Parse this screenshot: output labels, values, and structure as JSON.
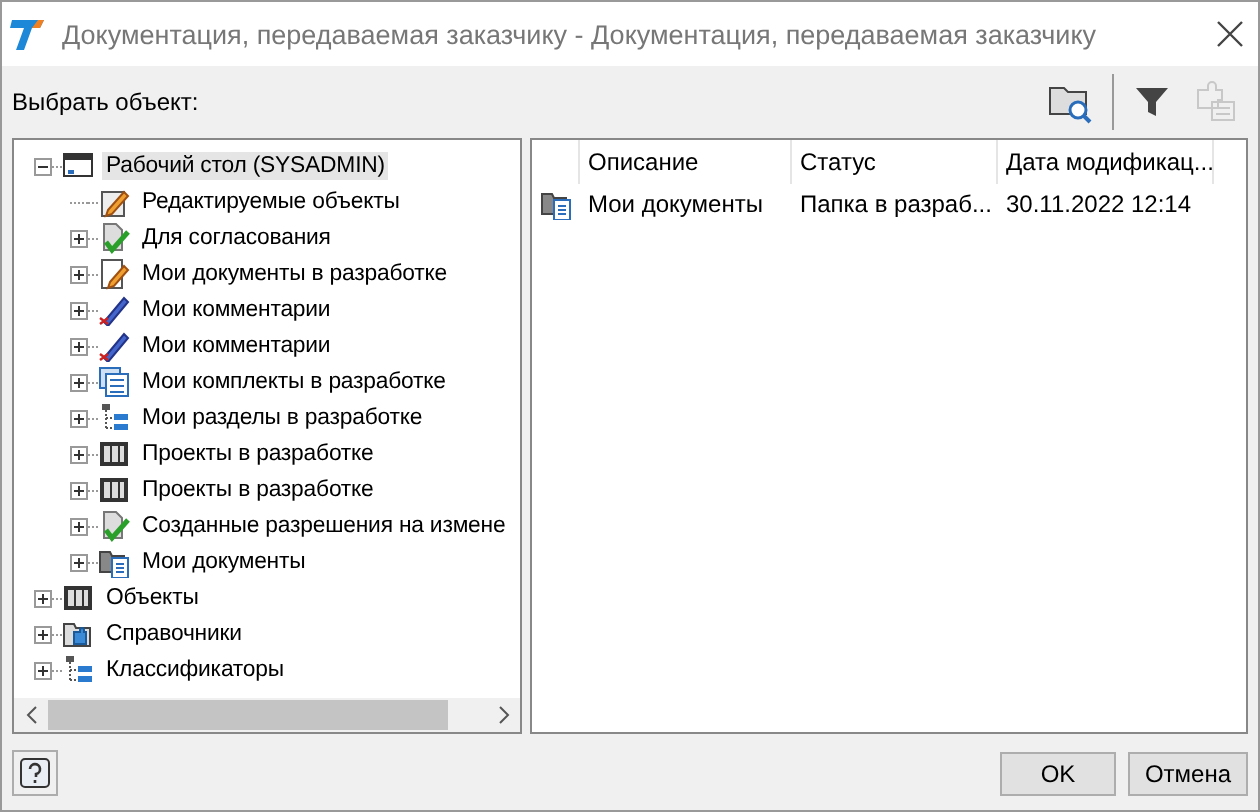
{
  "window": {
    "title": "Документация, передаваемая заказчику - Документация, передаваемая заказчику"
  },
  "prompt": "Выбрать объект:",
  "toolbar": [
    {
      "kind": "browse",
      "disabled": false
    },
    {
      "kind": "filter",
      "disabled": false
    },
    {
      "kind": "plugin",
      "disabled": true
    }
  ],
  "tree": [
    {
      "label": "Рабочий стол (SYSADMIN)",
      "kind": "desktop",
      "expanded": true,
      "selected": true,
      "children": [
        {
          "label": "Редактируемые объекты",
          "kind": "edit-list",
          "selected": false
        },
        {
          "label": "Для согласования",
          "kind": "approval",
          "expanded": false,
          "selected": false
        },
        {
          "label": "Мои документы в разработке",
          "kind": "document",
          "expanded": false,
          "selected": false
        },
        {
          "label": "Мои комментарии",
          "kind": "comments",
          "expanded": false,
          "selected": false
        },
        {
          "label": "Мои комментарии",
          "kind": "comments",
          "expanded": false,
          "selected": false
        },
        {
          "label": "Мои комплекты в разработке",
          "kind": "sets",
          "expanded": false,
          "selected": false
        },
        {
          "label": "Мои разделы в разработке",
          "kind": "sections",
          "expanded": false,
          "selected": false
        },
        {
          "label": "Проекты в разработке",
          "kind": "projects",
          "expanded": false,
          "selected": false
        },
        {
          "label": "Проекты в разработке",
          "kind": "projects",
          "expanded": false,
          "selected": false
        },
        {
          "label": "Созданные разрешения на измене",
          "kind": "approval",
          "expanded": false,
          "selected": false
        },
        {
          "label": "Мои документы",
          "kind": "folder",
          "expanded": false,
          "selected": false
        }
      ]
    },
    {
      "label": "Объекты",
      "kind": "projects",
      "expanded": false,
      "selected": false
    },
    {
      "label": "Справочники",
      "kind": "references",
      "expanded": false,
      "selected": false
    },
    {
      "label": "Классификаторы",
      "kind": "sections",
      "expanded": false,
      "selected": false
    }
  ],
  "list": {
    "columns": [
      "Описание",
      "Статус",
      "Дата модификац..."
    ],
    "rows": [
      {
        "kind": "folder",
        "cells": [
          "Мои документы",
          "Папка в разраб...",
          "30.11.2022 12:14"
        ],
        "selected": false
      }
    ]
  },
  "buttons": [
    {
      "label": "OK",
      "kind": "ok"
    },
    {
      "label": "Отмена",
      "kind": "cancel"
    }
  ]
}
